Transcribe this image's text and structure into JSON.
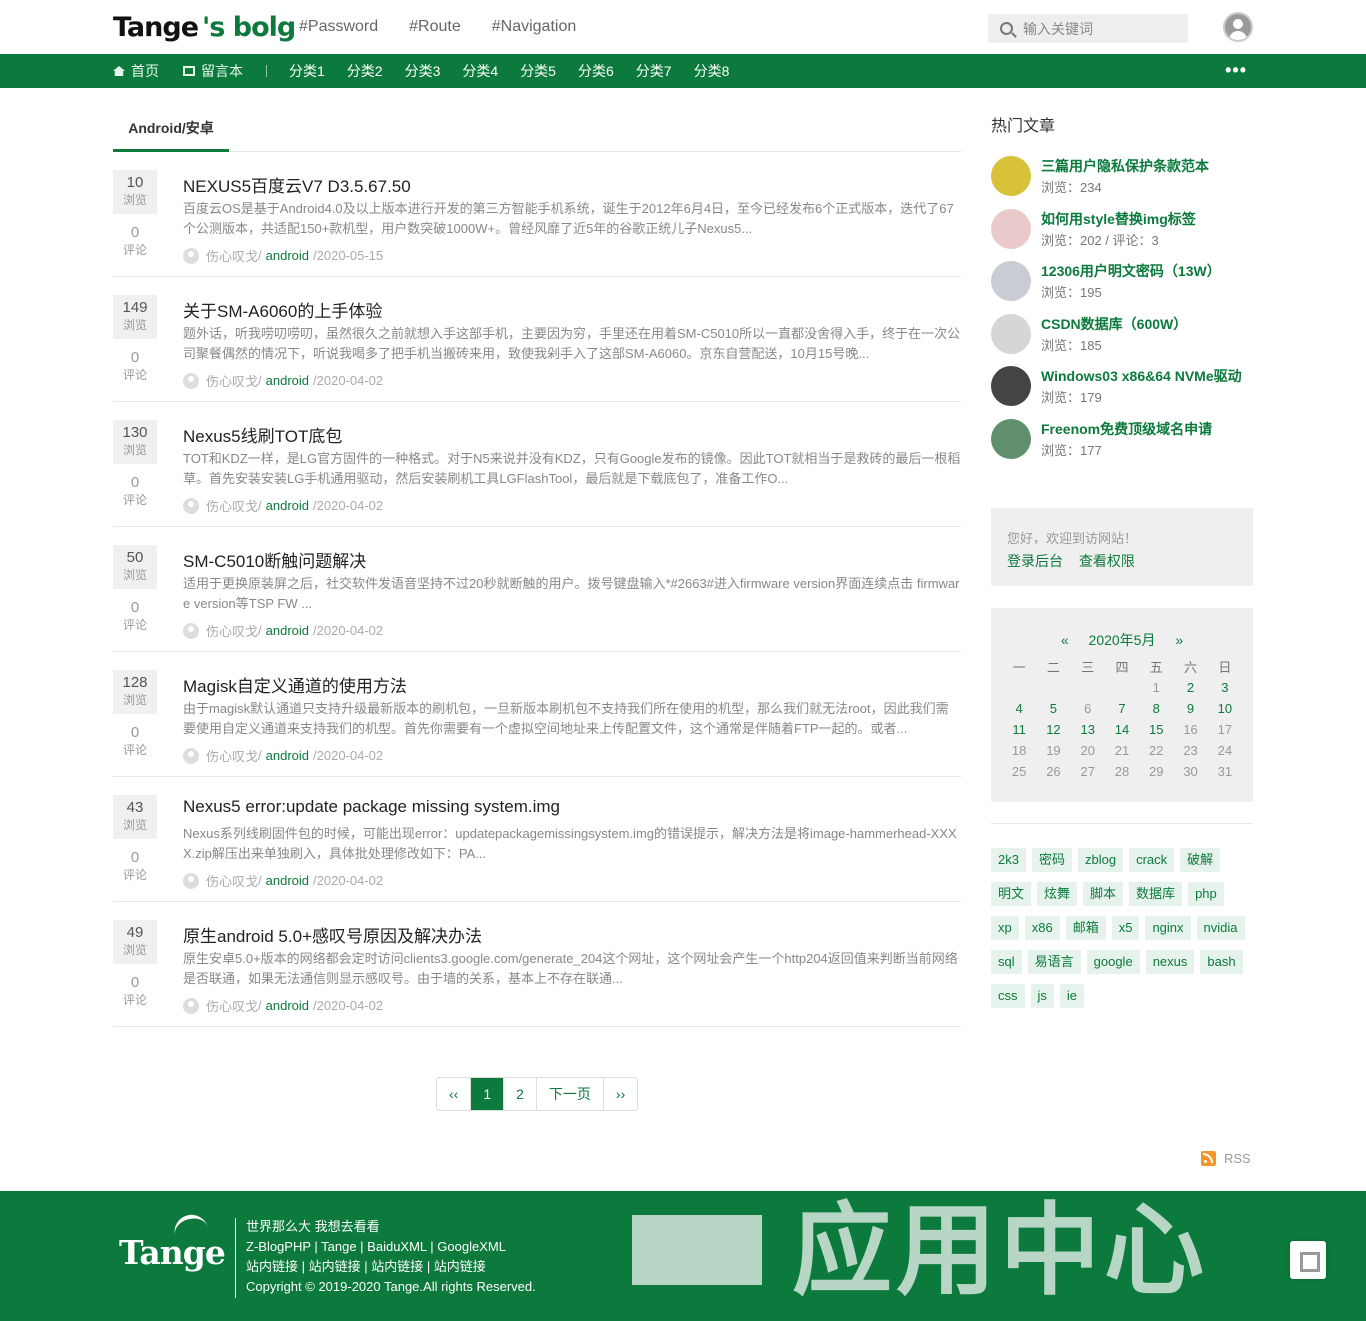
{
  "header": {
    "logo_main": "Tange",
    "logo_sub": "'s bolg",
    "top_links": [
      "#Password",
      "#Route",
      "#Navigation"
    ],
    "search_placeholder": "输入关键词"
  },
  "nav": {
    "home": "首页",
    "guestbook": "留言本",
    "categories": [
      "分类1",
      "分类2",
      "分类3",
      "分类4",
      "分类5",
      "分类6",
      "分类7",
      "分类8"
    ],
    "more": "•••"
  },
  "main": {
    "tab": "Android/安卓",
    "view_label": "浏览",
    "comment_label": "评论",
    "posts": [
      {
        "views": "10",
        "comments": "0",
        "title": "NEXUS5百度云V7 D3.5.67.50",
        "excerpt": "百度云OS是基于Android4.0及以上版本进行开发的第三方智能手机系统，诞生于2012年6月4日，至今已经发布6个正式版本，迭代了67个公测版本，共适配150+款机型，用户数突破1000W+。曾经风靡了近5年的谷歌正统儿子Nexus5...",
        "author": "伤心叹戈",
        "category": "android",
        "date": "2020-05-15"
      },
      {
        "views": "149",
        "comments": "0",
        "title": "关于SM-A6060的上手体验",
        "excerpt": "题外话，听我唠叨唠叨，虽然很久之前就想入手这部手机，主要因为穷，手里还在用着SM-C5010所以一直都没舍得入手，终于在一次公司聚餐偶然的情况下，听说我喝多了把手机当搬砖来用，致使我剁手入了这部SM-A6060。京东自营配送，10月15号晚...",
        "author": "伤心叹戈",
        "category": "android",
        "date": "2020-04-02"
      },
      {
        "views": "130",
        "comments": "0",
        "title": "Nexus5线刷TOT底包",
        "excerpt": "TOT和KDZ一样，是LG官方固件的一种格式。对于N5来说并没有KDZ，只有Google发布的镜像。因此TOT就相当于是救砖的最后一根稻草。首先安装安装LG手机通用驱动，然后安装刷机工具LGFlashTool，最后就是下载底包了，准备工作O...",
        "author": "伤心叹戈",
        "category": "android",
        "date": "2020-04-02"
      },
      {
        "views": "50",
        "comments": "0",
        "title": "SM-C5010断触问题解决",
        "excerpt": "适用于更换原装屏之后，社交软件发语音坚持不过20秒就断触的用户。拨号键盘输入*#2663#进入firmware version界面连续点击 firmware version等TSP FW ...",
        "author": "伤心叹戈",
        "category": "android",
        "date": "2020-04-02"
      },
      {
        "views": "128",
        "comments": "0",
        "title": "Magisk自定义通道的使用方法",
        "excerpt": "由于magisk默认通道只支持升级最新版本的刷机包，一旦新版本刷机包不支持我们所在使用的机型，那么我们就无法root，因此我们需要使用自定义通道来支持我们的机型。首先你需要有一个虚拟空间地址来上传配置文件，这个通常是伴随着FTP一起的。或者...",
        "author": "伤心叹戈",
        "category": "android",
        "date": "2020-04-02"
      },
      {
        "views": "43",
        "comments": "0",
        "title": "Nexus5 error:update package missing system.img",
        "excerpt": "Nexus系列线刷固件包的时候，可能出现error：updatepackagemissingsystem.img的错误提示，解决方法是将image-hammerhead-XXXX.zip解压出来单独刷入，具体批处理修改如下：PA...",
        "author": "伤心叹戈",
        "category": "android",
        "date": "2020-04-02"
      },
      {
        "views": "49",
        "comments": "0",
        "title": "原生android 5.0+感叹号原因及解决办法",
        "excerpt": "原生安卓5.0+版本的网络都会定时访问clients3.google.com/generate_204这个网址，这个网址会产生一个http204返回值来判断当前网络是否联通，如果无法通信则显示感叹号。由于墙的关系，基本上不存在联通...",
        "author": "伤心叹戈",
        "category": "android",
        "date": "2020-04-02"
      }
    ],
    "pager": [
      "‹‹",
      "1",
      "2",
      "下一页",
      "››"
    ]
  },
  "sidebar": {
    "hot_title": "热门文章",
    "hot": [
      {
        "title": "三篇用户隐私保护条款范本",
        "meta": "浏览：234",
        "color": "#d8c23a"
      },
      {
        "title": "如何用style替换img标签",
        "meta": "浏览：202 / 评论：3",
        "color": "#e9c9c9"
      },
      {
        "title": "12306用户明文密码（13W）",
        "meta": "浏览：195",
        "color": "#c9ccd2"
      },
      {
        "title": "CSDN数据库（600W）",
        "meta": "浏览：185",
        "color": "#d6d6d6"
      },
      {
        "title": "Windows03 x86&64 NVMe驱动",
        "meta": "浏览：179",
        "color": "#444444"
      },
      {
        "title": "Freenom免费顶级域名申请",
        "meta": "浏览：177",
        "color": "#5f8f6d"
      }
    ],
    "welcome": "您好，欢迎到访网站！",
    "login": "登录后台",
    "perm": "查看权限",
    "calendar": {
      "prev": "«",
      "month": "2020年5月",
      "next": "»",
      "weekdays": [
        "一",
        "二",
        "三",
        "四",
        "五",
        "六",
        "日"
      ]
    },
    "tags": [
      "2k3",
      "密码",
      "zblog",
      "crack",
      "破解",
      "明文",
      "炫舞",
      "脚本",
      "数据库",
      "php",
      "xp",
      "x86",
      "邮箱",
      "x5",
      "nginx",
      "nvidia",
      "sql",
      "易语言",
      "google",
      "nexus",
      "bash",
      "css",
      "js",
      "ie"
    ]
  },
  "rss": "RSS",
  "footer": {
    "logo": "Tange",
    "lines": [
      "世界那么大 我想去看看",
      "Z-BlogPHP | Tange | BaiduXML | GoogleXML",
      "站内链接 | 站内链接 | 站内链接 | 站内链接",
      "Copyright © 2019-2020 Tange.All rights Reserved."
    ],
    "watermark": "应用中心"
  }
}
